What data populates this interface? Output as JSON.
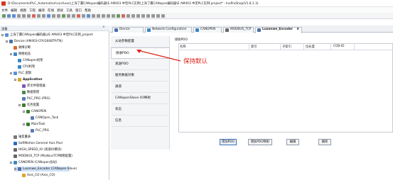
{
  "window": {
    "title": "D:\\Documents\\PLC_Automation\\ruichuan\\上海了赢CANopen编码器\\E AM403 中型PLC实例\\上海了赢CANopen编码器\\E AM403 中型PLC实例.project* - InoProShop(V1.8.1.3)"
  },
  "menu": [
    "文件",
    "编辑",
    "视图",
    "工程",
    "编译",
    "在线",
    "调试",
    "工具",
    "窗口",
    "帮助"
  ],
  "devices_panel": {
    "title": "设备"
  },
  "tree": [
    {
      "label": "上海了赢CANopen编码器以E AM403 中型PLC实例_project",
      "indent": 0,
      "icon": "project-icon",
      "toggle": "-"
    },
    {
      "label": "Device (AM403-CPU1608TP/TN)",
      "indent": 1,
      "icon": "device-icon",
      "toggle": "-"
    },
    {
      "label": "故障诊断",
      "indent": 2,
      "icon": "diagnosis-icon",
      "toggle": ""
    },
    {
      "label": "网络组态",
      "indent": 2,
      "icon": "network-icon",
      "toggle": "-"
    },
    {
      "label": "CANopen机架",
      "indent": 3,
      "icon": "canopen-rack-icon",
      "toggle": ""
    },
    {
      "label": "CPU机架",
      "indent": 3,
      "icon": "cpu-rack-icon",
      "toggle": ""
    },
    {
      "label": "PLC 逻辑",
      "indent": 2,
      "icon": "plc-logic-icon",
      "toggle": "-"
    },
    {
      "label": "Application",
      "indent": 3,
      "icon": "application-icon",
      "toggle": "-",
      "bold": true
    },
    {
      "label": "库文件管理器",
      "indent": 4,
      "icon": "library-icon",
      "toggle": ""
    },
    {
      "label": "数据管理",
      "indent": 4,
      "icon": "data-icon",
      "toggle": ""
    },
    {
      "label": "PLC_PRG (PRG)",
      "indent": 4,
      "icon": "program-icon",
      "toggle": ""
    },
    {
      "label": "任务配置",
      "indent": 4,
      "icon": "task-config-icon",
      "toggle": "-"
    },
    {
      "label": "CANOPEN",
      "indent": 5,
      "icon": "task-icon",
      "toggle": "-"
    },
    {
      "label": "CANOpen_Task",
      "indent": 6,
      "icon": "program-icon",
      "toggle": ""
    },
    {
      "label": "MainTask",
      "indent": 5,
      "icon": "task-icon",
      "toggle": "-"
    },
    {
      "label": "PLC_PRG",
      "indent": 6,
      "icon": "program-icon",
      "toggle": ""
    },
    {
      "label": "轴变量表",
      "indent": 2,
      "icon": "table-icon",
      "toggle": ""
    },
    {
      "label": "SoftMotion General Axis Pool",
      "indent": 2,
      "icon": "axis-pool-icon",
      "toggle": ""
    },
    {
      "label": "HIGH_SPEED_IO (高速IO模块)",
      "indent": 2,
      "icon": "io-icon",
      "toggle": ""
    },
    {
      "label": "MODBUS_TCP (ModbusTCP网络配置)",
      "indent": 2,
      "icon": "modbus-icon",
      "toggle": ""
    },
    {
      "label": "CANOPEN (CANopen总站)",
      "indent": 2,
      "icon": "canopen-icon",
      "toggle": "-"
    },
    {
      "label": "Lusenwe_Encoder (CANopen Slave)",
      "indent": 3,
      "icon": "encoder-icon",
      "toggle": "-",
      "selected": true
    },
    {
      "label": "Axis_CO (Axis_CO)",
      "indent": 4,
      "icon": "axis-icon",
      "toggle": ""
    }
  ],
  "tabs": [
    {
      "label": "Device",
      "icon": "device-icon"
    },
    {
      "label": "Network Configuration",
      "icon": "network-icon"
    },
    {
      "label": "CANOPEN",
      "icon": "canopen-icon"
    },
    {
      "label": "MODBUS_TCP",
      "icon": "modbus-icon"
    },
    {
      "label": "Lusenwe_Encoder",
      "icon": "encoder-icon",
      "active": true,
      "close": "✖"
    }
  ],
  "sidebar": [
    {
      "label": "从站参数配置"
    },
    {
      "label": "接收PDO",
      "active": true
    },
    {
      "label": "发送PDO"
    },
    {
      "label": "服务数据对象"
    },
    {
      "label": "通道"
    },
    {
      "label": "CANopenSlave I/O映射"
    },
    {
      "label": "状态"
    },
    {
      "label": "信息"
    }
  ],
  "content": {
    "section_title": "接收PDO",
    "columns": [
      "名称",
      "索引",
      "子索引",
      "位长度",
      "COB-ID"
    ],
    "annotation": "保持默认",
    "buttons": [
      "增加PDO",
      "增加PDO映射",
      "编辑",
      "删除"
    ]
  },
  "colors": {
    "accent": "#3a6fb6",
    "annotation": "#e0241c",
    "selection": "#cfe0f7"
  }
}
